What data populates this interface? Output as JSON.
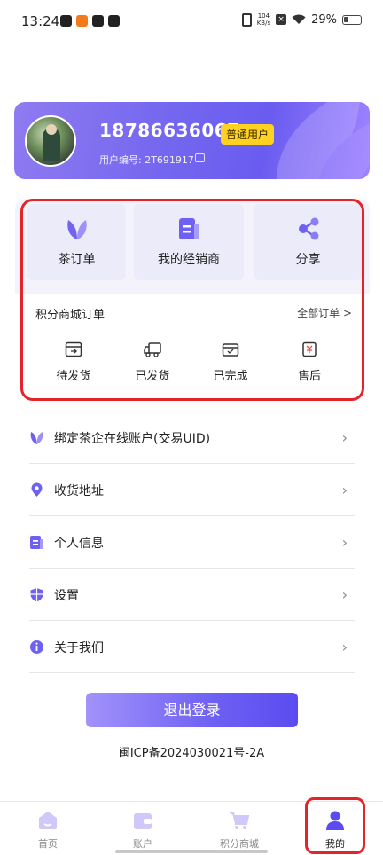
{
  "status_bar": {
    "time": "13:24",
    "net_speed_value": "104",
    "net_speed_unit": "KB/s",
    "battery": "29%"
  },
  "profile": {
    "phone": "18786636067",
    "badge": "普通用户",
    "uid": "用户编号: 2T691917"
  },
  "quick_actions": [
    {
      "label": "茶订单",
      "icon": "leaf-icon"
    },
    {
      "label": "我的经销商",
      "icon": "dealer-document-icon"
    },
    {
      "label": "分享",
      "icon": "share-icon"
    }
  ],
  "orders": {
    "title": "积分商城订单",
    "all_label": "全部订单 >",
    "items": [
      {
        "label": "待发货",
        "icon": "pending-ship-icon"
      },
      {
        "label": "已发货",
        "icon": "shipped-truck-icon"
      },
      {
        "label": "已完成",
        "icon": "completed-box-icon"
      },
      {
        "label": "售后",
        "icon": "after-sales-icon"
      }
    ]
  },
  "menu": [
    {
      "label": "绑定茶企在线账户(交易UID)",
      "icon": "leaf-icon"
    },
    {
      "label": "收货地址",
      "icon": "location-pin-icon"
    },
    {
      "label": "个人信息",
      "icon": "profile-card-icon"
    },
    {
      "label": "设置",
      "icon": "shield-icon"
    },
    {
      "label": "关于我们",
      "icon": "info-icon"
    }
  ],
  "logout_label": "退出登录",
  "icp": "闽ICP备2024030021号-2A",
  "tabs": [
    {
      "label": "首页",
      "icon": "home-icon",
      "active": false
    },
    {
      "label": "账户",
      "icon": "wallet-icon",
      "active": false
    },
    {
      "label": "积分商城",
      "icon": "cart-icon",
      "active": false
    },
    {
      "label": "我的",
      "icon": "user-icon",
      "active": true
    }
  ],
  "colors": {
    "accent": "#6e60f3",
    "badge": "#ffd21f",
    "highlight": "#e3252b"
  }
}
